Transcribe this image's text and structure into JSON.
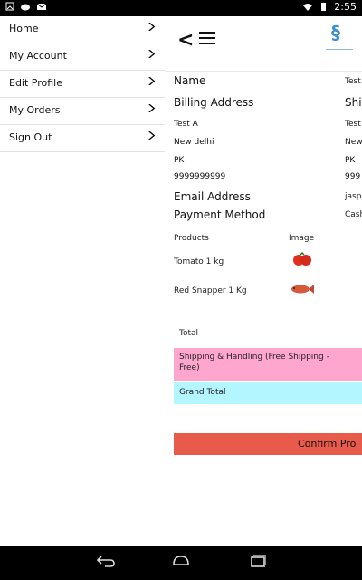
{
  "status_bar": {
    "time": "2:55"
  },
  "drawer": {
    "items": [
      {
        "label": "Home"
      },
      {
        "label": "My Account"
      },
      {
        "label": "Edit Profile"
      },
      {
        "label": "My Orders"
      },
      {
        "label": "Sign Out"
      }
    ]
  },
  "checkout": {
    "name_label": "Name",
    "name_value": "Test",
    "billing_label": "Billing Address",
    "shipping_label": "Ship",
    "billing": {
      "name": "Test A",
      "city": "New delhi",
      "country": "PK",
      "phone": "9999999999"
    },
    "shipping_partial": {
      "name": "Test",
      "city": "New",
      "country": "PK",
      "phone": "999"
    },
    "email_label": "Email Address",
    "email_value": "jasp",
    "payment_label": "Payment Method",
    "payment_value": "Cash",
    "products_header": "Products",
    "image_header": "Image",
    "products": [
      {
        "name": "Tomato 1 kg",
        "icon": "tomato-icon"
      },
      {
        "name": "Red Snapper 1 Kg",
        "icon": "fish-icon"
      }
    ],
    "total_label": "Total",
    "shipping_handling_label": "Shipping & Handling (Free Shipping - Free)",
    "grand_total_label": "Grand Total",
    "confirm_label": "Confirm Pro"
  },
  "colors": {
    "shipping_bg": "#ffa6cf",
    "grand_total_bg": "#b3f6ff",
    "confirm_bg": "#e85b4a",
    "logo": "#3a8fd0"
  }
}
